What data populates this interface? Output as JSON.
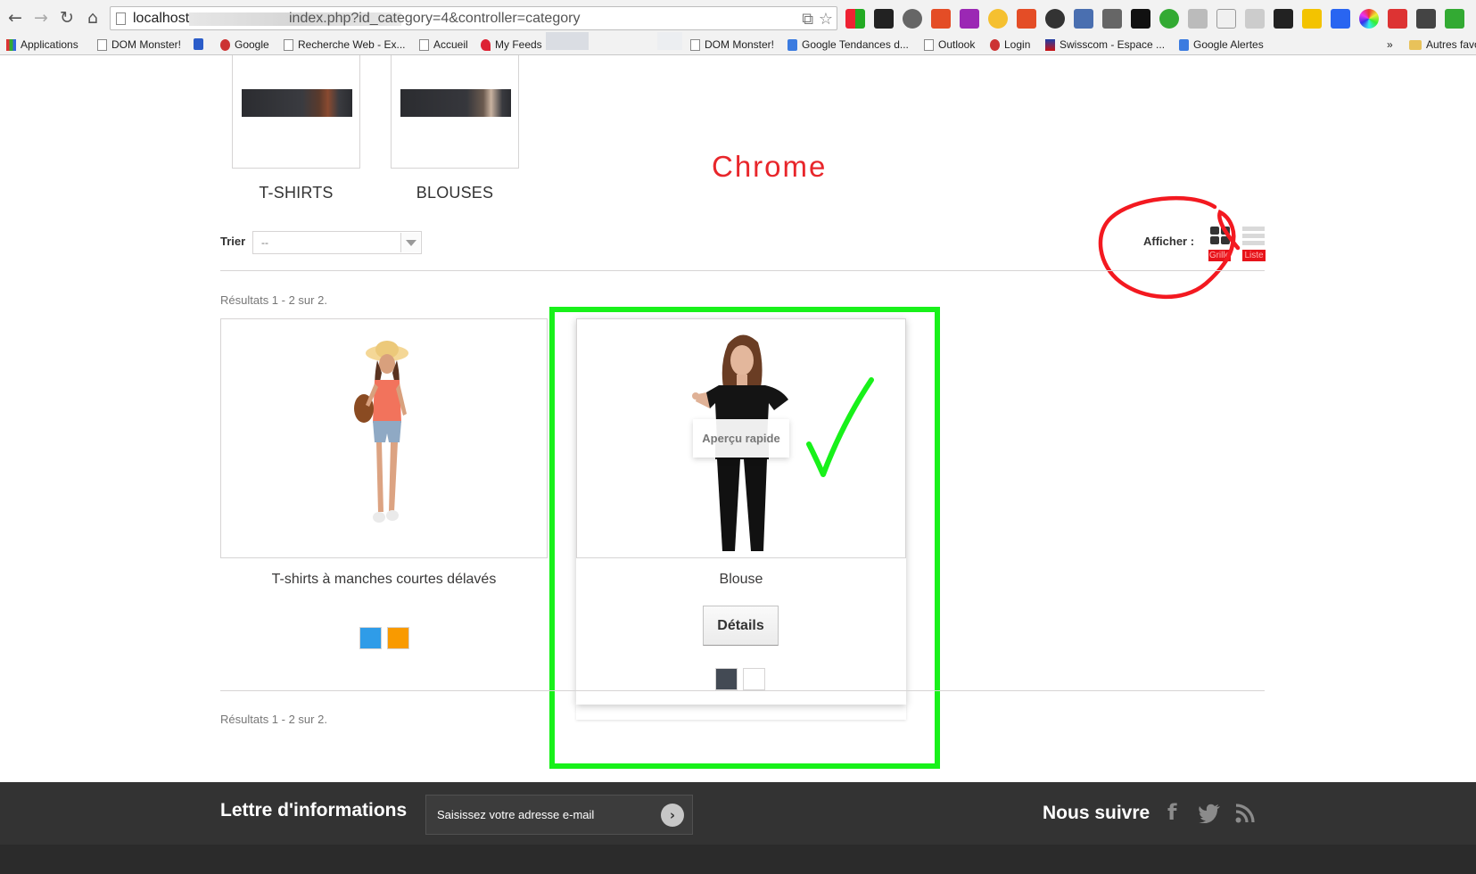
{
  "browser": {
    "url_host": "localhost",
    "url_path": "index.php?id_category=4&controller=category",
    "bookmarks": [
      {
        "label": "Applications"
      },
      {
        "label": "DOM Monster!"
      },
      {
        "label": "Google"
      },
      {
        "label": "Recherche Web - Ex..."
      },
      {
        "label": "Accueil"
      },
      {
        "label": "My Feeds"
      },
      {
        "label": "DOM Monster!"
      },
      {
        "label": "Google Tendances d..."
      },
      {
        "label": "Outlook"
      },
      {
        "label": "Login"
      },
      {
        "label": "Swisscom - Espace ..."
      },
      {
        "label": "Google Alertes"
      },
      {
        "label": "»"
      },
      {
        "label": "Autres favo"
      }
    ]
  },
  "subcategories": [
    {
      "name": "T-SHIRTS"
    },
    {
      "name": "BLOUSES"
    }
  ],
  "annotation": {
    "browser_label": "Chrome",
    "check_mark": "✓",
    "label_color": "#e8262b",
    "frame_color": "#18f11a"
  },
  "toolbar": {
    "sort_label": "Trier",
    "sort_value": "--",
    "view_label": "Afficher :",
    "grid_label": "Grille",
    "list_label": "Liste"
  },
  "results_top": "Résultats 1 - 2 sur 2.",
  "results_bottom": "Résultats 1 - 2 sur 2.",
  "products": [
    {
      "name": "T-shirts à manches courtes délavés",
      "swatches": [
        "#2f9ce8",
        "#f99a00"
      ]
    },
    {
      "name": "Blouse",
      "quick_view": "Aperçu rapide",
      "details_label": "Détails",
      "swatches": [
        "#434a54",
        "#ffffff"
      ]
    }
  ],
  "footer": {
    "newsletter_title": "Lettre d'informations",
    "newsletter_placeholder": "Saisissez votre adresse e-mail",
    "follow_title": "Nous suivre",
    "social": [
      "facebook-icon",
      "twitter-icon",
      "rss-icon"
    ]
  }
}
